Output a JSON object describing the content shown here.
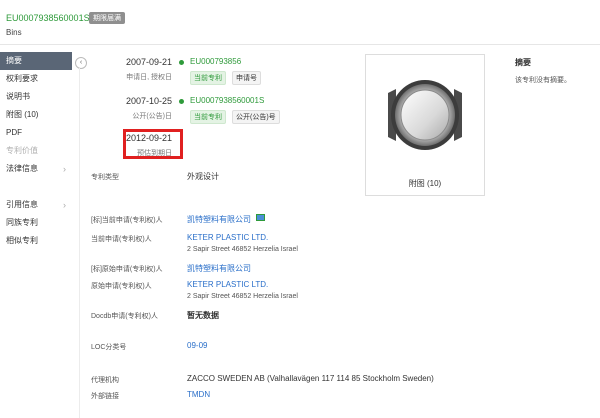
{
  "header": {
    "patent_no": "EU0007938560001S",
    "status_badge": "期限届满",
    "subtitle": "Bins"
  },
  "sidebar": {
    "items": [
      {
        "label": "摘要"
      },
      {
        "label": "权利要求"
      },
      {
        "label": "说明书"
      },
      {
        "label": "附图 (10)"
      },
      {
        "label": "PDF"
      },
      {
        "label": "专利价值"
      },
      {
        "label": "法律信息"
      },
      {
        "label": "引用信息"
      },
      {
        "label": "同族专利"
      },
      {
        "label": "相似专利"
      }
    ],
    "collapse_glyph": "‹"
  },
  "timeline": [
    {
      "date": "2007-09-21",
      "label": "申请日, 授权日",
      "number": "EU000793856",
      "tags": [
        "当前专利",
        "申请号"
      ]
    },
    {
      "date": "2007-10-25",
      "label": "公开(公告)日",
      "number": "EU0007938560001S",
      "tags": [
        "当前专利",
        "公开(公告)号"
      ]
    },
    {
      "date": "2012-09-21",
      "label": "预估到期日"
    }
  ],
  "fields": {
    "type_label": "专利类型",
    "type_value": "外观设计",
    "cur_std_label": "[标]当前申请(专利权)人",
    "cur_std_value": "凯特塑料有限公司",
    "cur_label": "当前申请(专利权)人",
    "cur_name": "KETER PLASTIC LTD.",
    "cur_addr": "2 Sapir Street 46852 Herzelia Israel",
    "orig_std_label": "[标]原始申请(专利权)人",
    "orig_std_value": "凯特塑料有限公司",
    "orig_label": "原始申请(专利权)人",
    "orig_name": "KETER PLASTIC LTD.",
    "orig_addr": "2 Sapir Street 46852 Herzelia Israel",
    "docdb_label": "Docdb申请(专利权)人",
    "docdb_value": "暂无数据",
    "loc_label": "LOC分类号",
    "loc_value": "09-09",
    "agent_label": "代理机构",
    "agent_value": "ZACCO SWEDEN AB (Valhallavägen 117 114 85 Stockholm Sweden)",
    "ext_label": "外部链接",
    "ext_value": "TMDN"
  },
  "figure": {
    "caption": "附图 (10)"
  },
  "abstract": {
    "title": "摘要",
    "text": "该专利没有摘要。"
  },
  "colors": {
    "green": "#2e9a3a",
    "blue": "#2a6fc9",
    "highlight": "#e02020",
    "active": "#5a6676"
  }
}
